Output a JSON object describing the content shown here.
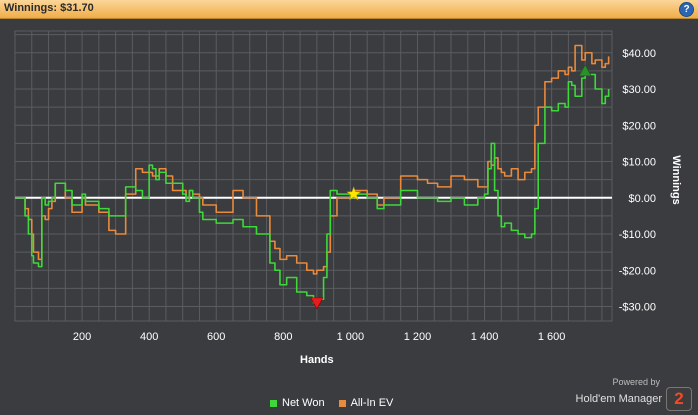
{
  "header": {
    "title": "Winnings: $31.70",
    "help_icon": "?"
  },
  "colors": {
    "background": "#3a3c40",
    "grid": "#5a5c60",
    "net_won": "#3fd83a",
    "all_in_ev": "#e98a3c",
    "zero_line": "#ffffff",
    "marker_high": "#ffe700",
    "marker_low": "#e81c1c",
    "marker_end": "#2b8f2b"
  },
  "chart_data": {
    "type": "line",
    "xlabel": "Hands",
    "ylabel": "Winnings",
    "xlim": [
      0,
      1780
    ],
    "ylim": [
      -34,
      46
    ],
    "x_ticks": [
      200,
      400,
      600,
      800,
      1000,
      1200,
      1400,
      1600
    ],
    "x_tick_labels": [
      "200",
      "400",
      "600",
      "800",
      "1 000",
      "1 200",
      "1 400",
      "1 600"
    ],
    "y_ticks": [
      -30,
      -20,
      -10,
      0,
      10,
      20,
      30,
      40
    ],
    "y_tick_labels": [
      "-$30.00",
      "-$20.00",
      "-$10.00",
      "$0.00",
      "$10.00",
      "$20.00",
      "$30.00",
      "$40.00"
    ],
    "grid": true,
    "legend_position": "bottom",
    "x": [
      0,
      30,
      40,
      50,
      55,
      70,
      80,
      90,
      100,
      110,
      120,
      150,
      170,
      200,
      210,
      250,
      280,
      300,
      330,
      360,
      380,
      400,
      410,
      420,
      430,
      450,
      470,
      500,
      510,
      520,
      530,
      550,
      560,
      600,
      650,
      680,
      720,
      760,
      775,
      790,
      810,
      840,
      870,
      890,
      900,
      920,
      930,
      940,
      960,
      1000,
      1010,
      1050,
      1080,
      1100,
      1150,
      1200,
      1230,
      1260,
      1300,
      1340,
      1380,
      1400,
      1410,
      1420,
      1430,
      1440,
      1450,
      1460,
      1480,
      1500,
      1520,
      1540,
      1550,
      1560,
      1580,
      1600,
      1620,
      1640,
      1650,
      1660,
      1670,
      1690,
      1700,
      1720,
      1730,
      1750,
      1760,
      1770
    ],
    "series": [
      {
        "name": "Net Won",
        "values": [
          0,
          -5,
          -10,
          -16,
          -18,
          -19,
          0,
          -2,
          -1,
          0,
          4,
          2,
          -2,
          1,
          -1,
          -3,
          -5,
          -5,
          3,
          2,
          0,
          9,
          8,
          5,
          7,
          4,
          4,
          1,
          -1,
          2,
          0,
          -4,
          -6,
          -7,
          -6,
          -8,
          -10,
          -18,
          -20,
          -24,
          -22,
          -26,
          -27,
          -29,
          -28,
          -22,
          -10,
          2,
          1,
          0,
          1,
          0,
          -3,
          -2,
          2,
          0,
          0,
          -1,
          0,
          -2,
          0,
          1,
          8,
          15,
          2,
          -5,
          -8,
          -7,
          -9,
          -10,
          -11,
          -10,
          -3,
          15,
          25,
          24,
          26,
          25,
          32,
          31,
          28,
          33,
          34,
          34,
          30,
          26,
          28,
          30
        ]
      },
      {
        "name": "All-In EV",
        "values": [
          0,
          -3,
          -6,
          -10,
          -15,
          -17,
          -5,
          -6,
          -3,
          -1,
          4,
          0,
          -4,
          0,
          -2,
          -4,
          -9,
          -10,
          1,
          8,
          7,
          7,
          6,
          6,
          8,
          6,
          2,
          2,
          0,
          2,
          1,
          0,
          -2,
          -4,
          2,
          0,
          -5,
          -12,
          -14,
          -17,
          -16,
          -18,
          -20,
          -21,
          -20,
          -19,
          -15,
          -5,
          0,
          0,
          2,
          1,
          -2,
          0,
          6,
          5,
          4,
          3,
          6,
          5,
          3,
          3,
          10,
          9,
          11,
          8,
          7,
          6,
          8,
          5,
          7,
          8,
          20,
          25,
          32,
          33,
          35,
          34,
          36,
          35,
          42,
          38,
          40,
          37,
          38,
          36,
          37,
          39
        ]
      }
    ],
    "markers": [
      {
        "type": "star",
        "x": 1010,
        "y": 1
      },
      {
        "type": "triangle-down",
        "x": 900,
        "y": -29
      },
      {
        "type": "triangle-up",
        "x": 1700,
        "y": 35
      }
    ]
  },
  "legend": {
    "net_won": "Net Won",
    "all_in_ev": "All-In EV"
  },
  "brand": {
    "powered_by": "Powered by",
    "product": "Hold'em Manager",
    "logo_text": "2"
  }
}
